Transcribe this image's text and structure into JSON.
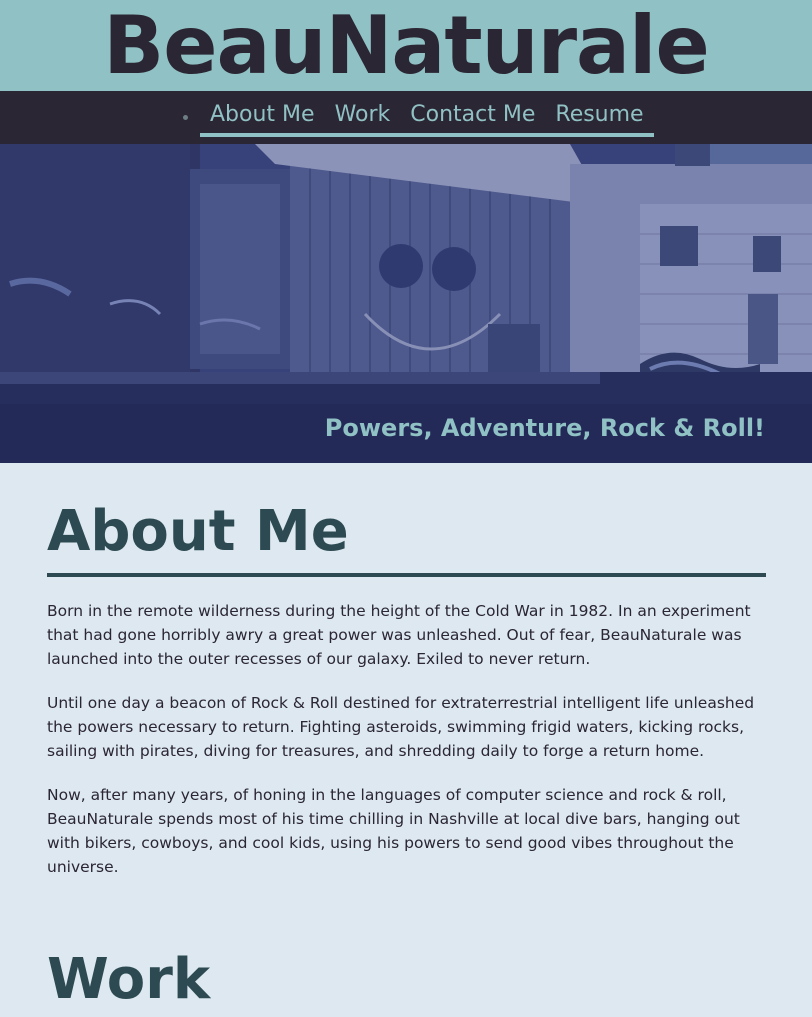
{
  "header": {
    "site_title": "BeauNaturale"
  },
  "nav": {
    "items": [
      {
        "label": "About Me"
      },
      {
        "label": "Work"
      },
      {
        "label": "Contact Me"
      },
      {
        "label": "Resume"
      }
    ]
  },
  "hero": {
    "tagline": "Powers, Adventure, Rock & Roll!"
  },
  "about": {
    "heading": "About Me",
    "paragraphs": [
      "Born in the remote wilderness during the height of the Cold War in 1982. In an experiment that had gone horribly awry a great power was unleashed. Out of fear, BeauNaturale was launched into the outer recesses of our galaxy. Exiled to never return.",
      "Until one day a beacon of Rock & Roll destined for extraterrestrial intelligent life unleashed the powers necessary to return. Fighting asteroids, swimming frigid waters, kicking rocks, sailing with pirates, diving for treasures, and shredding daily to forge a return home.",
      "Now, after many years, of honing in the languages of computer science and rock & roll, BeauNaturale spends most of his time chilling in Nashville at local dive bars, hanging out with bikers, cowboys, and cool kids, using his powers to send good vibes throughout the universe."
    ]
  },
  "work": {
    "heading": "Work"
  },
  "colors": {
    "header_bg": "#90c1c4",
    "nav_bg": "#2b2633",
    "page_bg": "#dde8f0",
    "heading": "#2d4a52",
    "hero_overlay": "#2d3a6e"
  }
}
